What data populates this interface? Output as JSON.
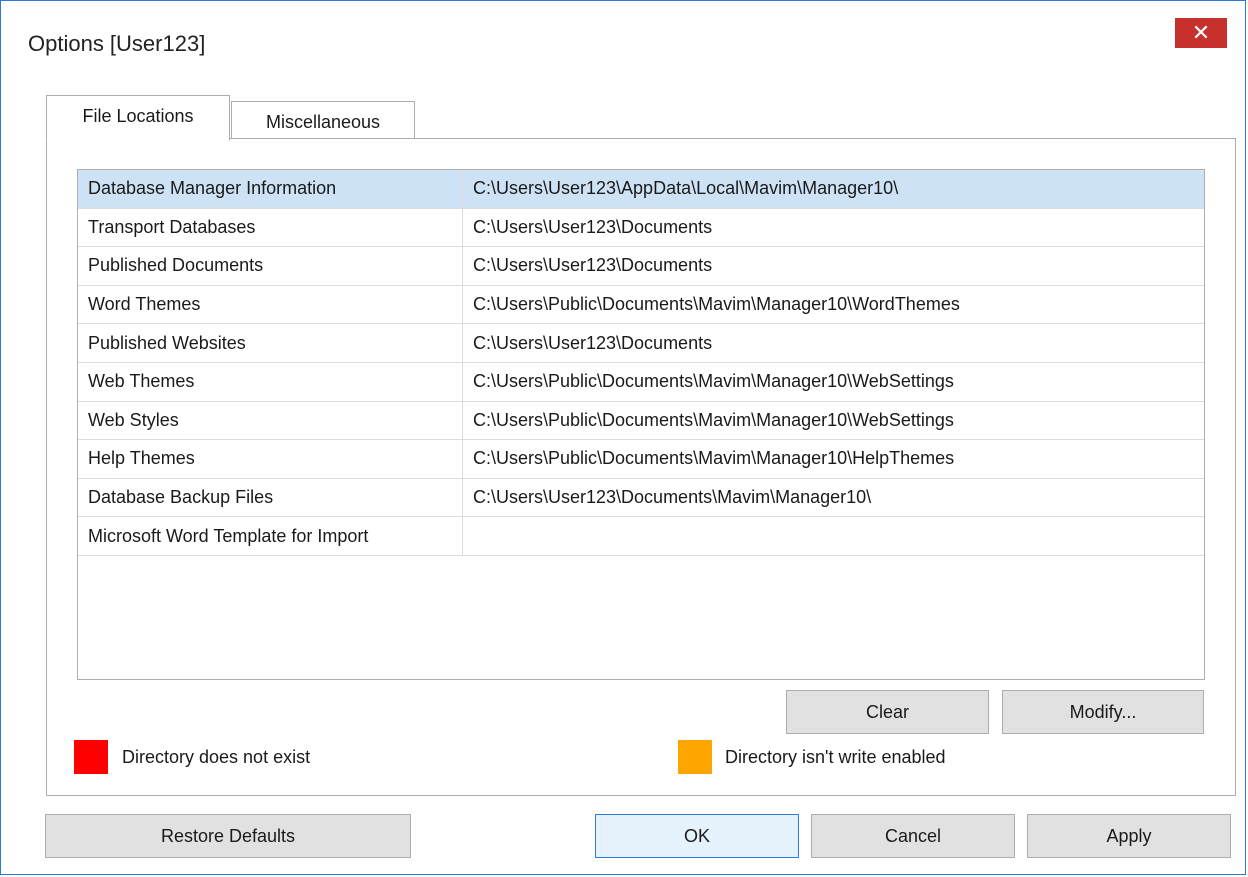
{
  "window": {
    "title": "Options [User123]",
    "close_glyph": "✕"
  },
  "tabs": [
    {
      "label": "File Locations",
      "active": true
    },
    {
      "label": "Miscellaneous",
      "active": false
    }
  ],
  "locations": {
    "rows": [
      {
        "name": "Database Manager Information",
        "path": "C:\\Users\\User123\\AppData\\Local\\Mavim\\Manager10\\",
        "selected": true
      },
      {
        "name": "Transport Databases",
        "path": "C:\\Users\\User123\\Documents"
      },
      {
        "name": "Published Documents",
        "path": "C:\\Users\\User123\\Documents"
      },
      {
        "name": "Word Themes",
        "path": "C:\\Users\\Public\\Documents\\Mavim\\Manager10\\WordThemes"
      },
      {
        "name": "Published Websites",
        "path": "C:\\Users\\User123\\Documents"
      },
      {
        "name": "Web Themes",
        "path": "C:\\Users\\Public\\Documents\\Mavim\\Manager10\\WebSettings"
      },
      {
        "name": "Web Styles",
        "path": "C:\\Users\\Public\\Documents\\Mavim\\Manager10\\WebSettings"
      },
      {
        "name": "Help Themes",
        "path": "C:\\Users\\Public\\Documents\\Mavim\\Manager10\\HelpThemes"
      },
      {
        "name": "Database Backup Files",
        "path": "C:\\Users\\User123\\Documents\\Mavim\\Manager10\\"
      },
      {
        "name": "Microsoft Word Template for Import",
        "path": ""
      }
    ]
  },
  "actions": {
    "clear_label": "Clear",
    "modify_label": "Modify..."
  },
  "legend": {
    "missing": {
      "label": "Directory does not exist",
      "color": "#ff0000"
    },
    "readonly": {
      "label": "Directory isn't write enabled",
      "color": "#ffa500"
    }
  },
  "footer": {
    "restore_label": "Restore Defaults",
    "ok_label": "OK",
    "cancel_label": "Cancel",
    "apply_label": "Apply"
  }
}
